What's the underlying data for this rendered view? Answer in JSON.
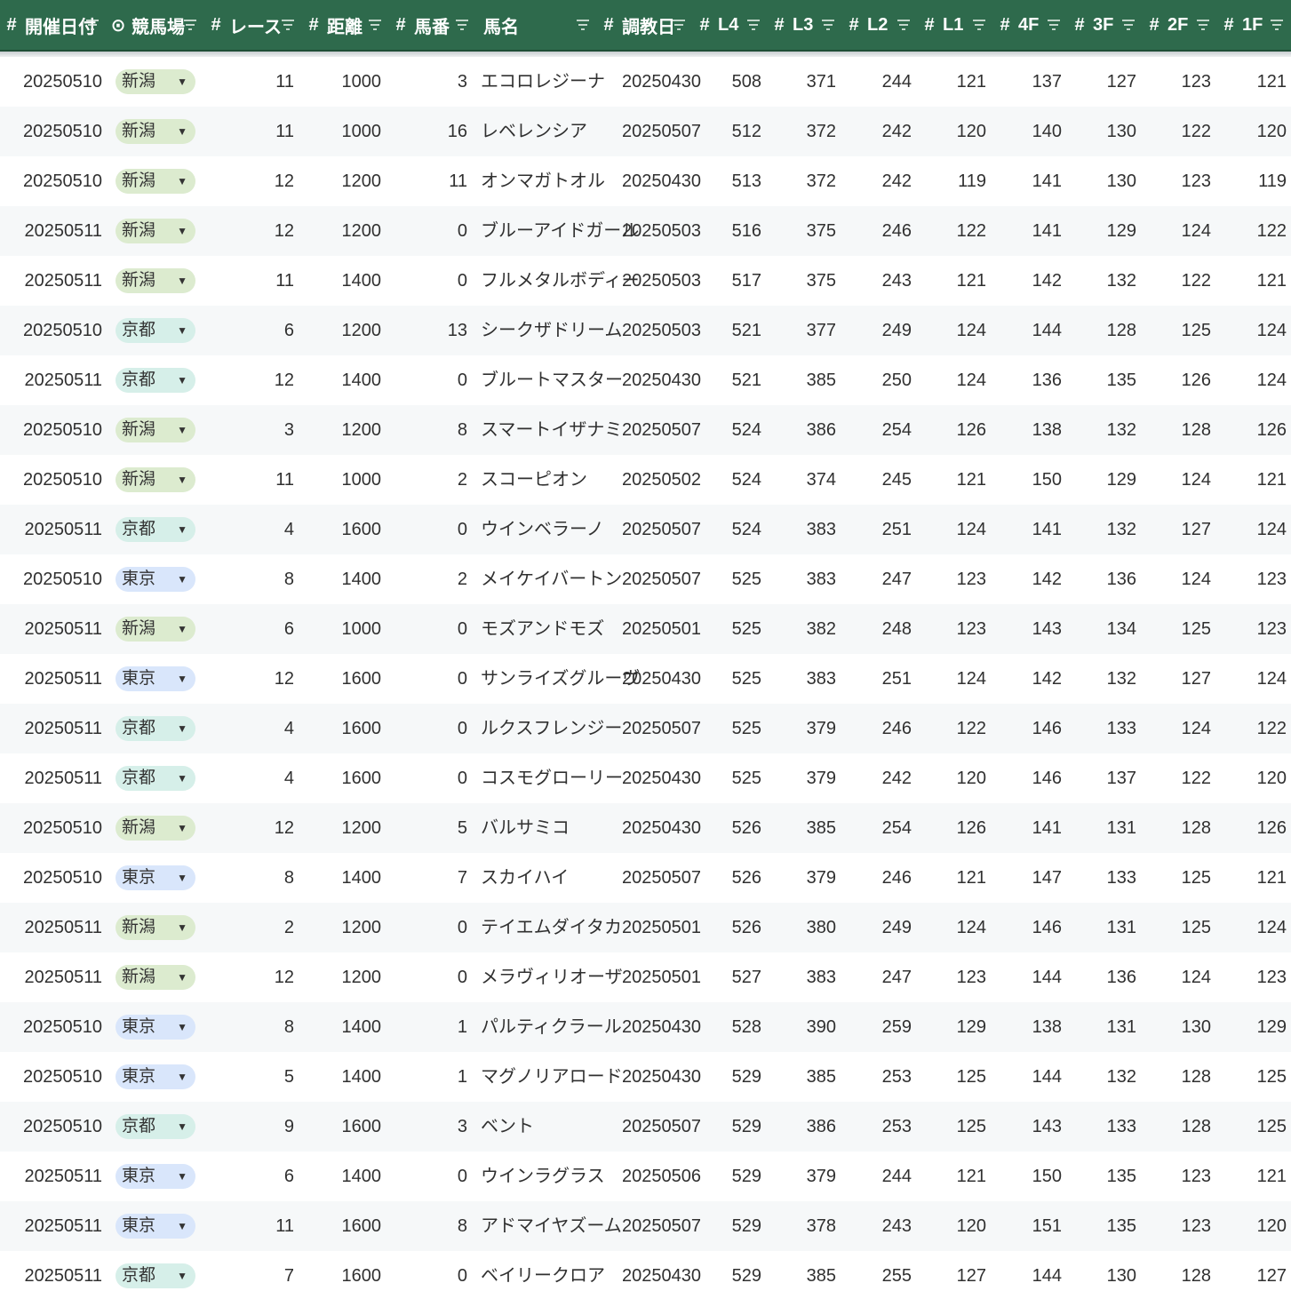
{
  "header": {
    "columns": [
      {
        "type_icon": "#",
        "label": "開催日付",
        "filter_icon": "filter-icon"
      },
      {
        "type_icon": "⊙",
        "label": "競馬場",
        "filter_icon": "filter-icon"
      },
      {
        "type_icon": "#",
        "label": "レース",
        "filter_icon": "filter-icon"
      },
      {
        "type_icon": "#",
        "label": "距離",
        "filter_icon": "filter-icon"
      },
      {
        "type_icon": "#",
        "label": "馬番",
        "filter_icon": "filter-icon"
      },
      {
        "type_icon": "",
        "label": "馬名",
        "filter_icon": "filter-icon"
      },
      {
        "type_icon": "#",
        "label": "調教日",
        "filter_icon": "filter-icon"
      },
      {
        "type_icon": "#",
        "label": "L4",
        "filter_icon": "filter-icon"
      },
      {
        "type_icon": "#",
        "label": "L3",
        "filter_icon": "filter-icon"
      },
      {
        "type_icon": "#",
        "label": "L2",
        "filter_icon": "filter-icon"
      },
      {
        "type_icon": "#",
        "label": "L1",
        "filter_icon": "filter-icon"
      },
      {
        "type_icon": "#",
        "label": "4F",
        "filter_icon": "filter-icon"
      },
      {
        "type_icon": "#",
        "label": "3F",
        "filter_icon": "filter-icon"
      },
      {
        "type_icon": "#",
        "label": "2F",
        "filter_icon": "filter-icon"
      },
      {
        "type_icon": "#",
        "label": "1F",
        "filter_icon": "filter-icon"
      }
    ]
  },
  "colors": {
    "header_bg": "#2e6a4c",
    "venue_chip": {
      "新潟": "#dcebcf",
      "京都": "#d6efe9",
      "東京": "#d9e6fb"
    },
    "dropdown_arrow": "chevron-down-icon"
  },
  "rows": [
    [
      "20250510",
      "新潟",
      "11",
      "1000",
      "3",
      "エコロレジーナ",
      "20250430",
      "508",
      "371",
      "244",
      "121",
      "137",
      "127",
      "123",
      "121"
    ],
    [
      "20250510",
      "新潟",
      "11",
      "1000",
      "16",
      "レベレンシア",
      "20250507",
      "512",
      "372",
      "242",
      "120",
      "140",
      "130",
      "122",
      "120"
    ],
    [
      "20250510",
      "新潟",
      "12",
      "1200",
      "11",
      "オンマガトオル",
      "20250430",
      "513",
      "372",
      "242",
      "119",
      "141",
      "130",
      "123",
      "119"
    ],
    [
      "20250511",
      "新潟",
      "12",
      "1200",
      "0",
      "ブルーアイドガール",
      "20250503",
      "516",
      "375",
      "246",
      "122",
      "141",
      "129",
      "124",
      "122"
    ],
    [
      "20250511",
      "新潟",
      "11",
      "1400",
      "0",
      "フルメタルボディー",
      "20250503",
      "517",
      "375",
      "243",
      "121",
      "142",
      "132",
      "122",
      "121"
    ],
    [
      "20250510",
      "京都",
      "6",
      "1200",
      "13",
      "シークザドリーム",
      "20250503",
      "521",
      "377",
      "249",
      "124",
      "144",
      "128",
      "125",
      "124"
    ],
    [
      "20250511",
      "京都",
      "12",
      "1400",
      "0",
      "ブルートマスター",
      "20250430",
      "521",
      "385",
      "250",
      "124",
      "136",
      "135",
      "126",
      "124"
    ],
    [
      "20250510",
      "新潟",
      "3",
      "1200",
      "8",
      "スマートイザナミ",
      "20250507",
      "524",
      "386",
      "254",
      "126",
      "138",
      "132",
      "128",
      "126"
    ],
    [
      "20250510",
      "新潟",
      "11",
      "1000",
      "2",
      "スコーピオン",
      "20250502",
      "524",
      "374",
      "245",
      "121",
      "150",
      "129",
      "124",
      "121"
    ],
    [
      "20250511",
      "京都",
      "4",
      "1600",
      "0",
      "ウインベラーノ",
      "20250507",
      "524",
      "383",
      "251",
      "124",
      "141",
      "132",
      "127",
      "124"
    ],
    [
      "20250510",
      "東京",
      "8",
      "1400",
      "2",
      "メイケイバートン",
      "20250507",
      "525",
      "383",
      "247",
      "123",
      "142",
      "136",
      "124",
      "123"
    ],
    [
      "20250511",
      "新潟",
      "6",
      "1000",
      "0",
      "モズアンドモズ",
      "20250501",
      "525",
      "382",
      "248",
      "123",
      "143",
      "134",
      "125",
      "123"
    ],
    [
      "20250511",
      "東京",
      "12",
      "1600",
      "0",
      "サンライズグルーヴ",
      "20250430",
      "525",
      "383",
      "251",
      "124",
      "142",
      "132",
      "127",
      "124"
    ],
    [
      "20250511",
      "京都",
      "4",
      "1600",
      "0",
      "ルクスフレンジー",
      "20250507",
      "525",
      "379",
      "246",
      "122",
      "146",
      "133",
      "124",
      "122"
    ],
    [
      "20250511",
      "京都",
      "4",
      "1600",
      "0",
      "コスモグローリー",
      "20250430",
      "525",
      "379",
      "242",
      "120",
      "146",
      "137",
      "122",
      "120"
    ],
    [
      "20250510",
      "新潟",
      "12",
      "1200",
      "5",
      "バルサミコ",
      "20250430",
      "526",
      "385",
      "254",
      "126",
      "141",
      "131",
      "128",
      "126"
    ],
    [
      "20250510",
      "東京",
      "8",
      "1400",
      "7",
      "スカイハイ",
      "20250507",
      "526",
      "379",
      "246",
      "121",
      "147",
      "133",
      "125",
      "121"
    ],
    [
      "20250511",
      "新潟",
      "2",
      "1200",
      "0",
      "テイエムダイタカ",
      "20250501",
      "526",
      "380",
      "249",
      "124",
      "146",
      "131",
      "125",
      "124"
    ],
    [
      "20250511",
      "新潟",
      "12",
      "1200",
      "0",
      "メラヴィリオーザ",
      "20250501",
      "527",
      "383",
      "247",
      "123",
      "144",
      "136",
      "124",
      "123"
    ],
    [
      "20250510",
      "東京",
      "8",
      "1400",
      "1",
      "パルティクラール",
      "20250430",
      "528",
      "390",
      "259",
      "129",
      "138",
      "131",
      "130",
      "129"
    ],
    [
      "20250510",
      "東京",
      "5",
      "1400",
      "1",
      "マグノリアロード",
      "20250430",
      "529",
      "385",
      "253",
      "125",
      "144",
      "132",
      "128",
      "125"
    ],
    [
      "20250510",
      "京都",
      "9",
      "1600",
      "3",
      "ベント",
      "20250507",
      "529",
      "386",
      "253",
      "125",
      "143",
      "133",
      "128",
      "125"
    ],
    [
      "20250511",
      "東京",
      "6",
      "1400",
      "0",
      "ウインラグラス",
      "20250506",
      "529",
      "379",
      "244",
      "121",
      "150",
      "135",
      "123",
      "121"
    ],
    [
      "20250511",
      "東京",
      "11",
      "1600",
      "8",
      "アドマイヤズーム",
      "20250507",
      "529",
      "378",
      "243",
      "120",
      "151",
      "135",
      "123",
      "120"
    ],
    [
      "20250511",
      "京都",
      "7",
      "1600",
      "0",
      "ベイリークロア",
      "20250430",
      "529",
      "385",
      "255",
      "127",
      "144",
      "130",
      "128",
      "127"
    ]
  ]
}
